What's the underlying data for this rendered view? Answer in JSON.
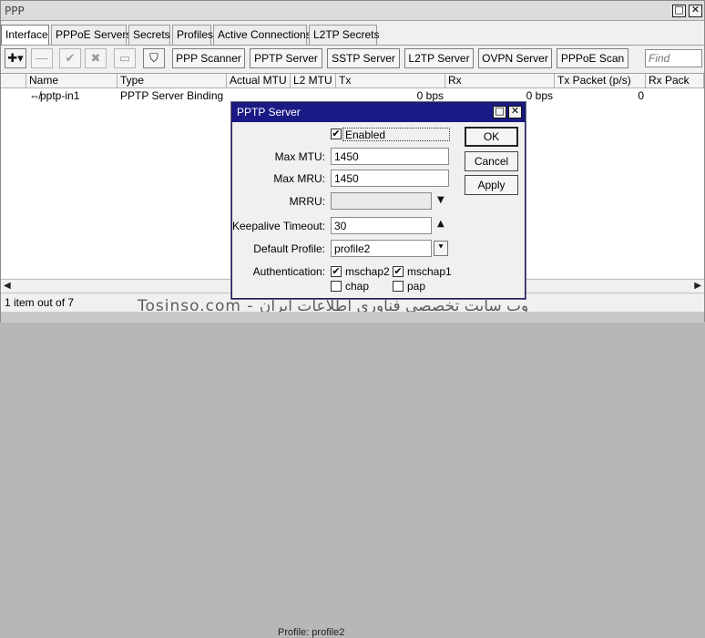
{
  "window": {
    "title": "PPP",
    "restore_glyph": "□",
    "close_glyph": "✕"
  },
  "tabs": [
    {
      "label": "Interface",
      "active": true
    },
    {
      "label": "PPPoE Servers"
    },
    {
      "label": "Secrets"
    },
    {
      "label": "Profiles"
    },
    {
      "label": "Active Connections"
    },
    {
      "label": "L2TP Secrets"
    }
  ],
  "toolbar": {
    "icons": [
      {
        "name": "add-icon",
        "glyph": "✚▾"
      },
      {
        "name": "remove-icon",
        "glyph": "—"
      },
      {
        "name": "enable-icon",
        "glyph": "✔"
      },
      {
        "name": "disable-icon",
        "glyph": "✖"
      },
      {
        "name": "comment-icon",
        "glyph": "▭"
      },
      {
        "name": "filter-icon",
        "glyph": "⛉"
      }
    ],
    "buttons": [
      "PPP Scanner",
      "PPTP Server",
      "SSTP Server",
      "L2TP Server",
      "OVPN Server",
      "PPPoE Scan"
    ],
    "find_placeholder": "Find"
  },
  "table": {
    "columns": [
      "Name",
      "Type",
      "Actual MTU",
      "L2 MTU",
      "Tx",
      "Rx",
      "Tx Packet (p/s)",
      "Rx Pack"
    ],
    "rows": [
      {
        "name": "⇎pptp-in1",
        "type": "PPTP Server Binding",
        "actual_mtu": "",
        "l2_mtu": "",
        "tx": "0 bps",
        "rx": "0 bps",
        "tx_packet": "0",
        "rx_packet": ""
      }
    ]
  },
  "status": {
    "items": "1 item out of 7"
  },
  "watermark": "Tosinso.com - وب سایت تخصصی فناوری اطلاعات ایران",
  "bottom_strip": {
    "profile": "Profile:  profile2"
  },
  "dialog": {
    "title": "PPTP Server",
    "enabled": {
      "label": "Enabled",
      "checked": true
    },
    "max_mtu": {
      "label": "Max MTU:",
      "value": "1450"
    },
    "max_mru": {
      "label": "Max MRU:",
      "value": "1450"
    },
    "mrru": {
      "label": "MRRU:",
      "value": ""
    },
    "keepalive": {
      "label": "Keepalive Timeout:",
      "value": "30"
    },
    "default_profile": {
      "label": "Default Profile:",
      "value": "profile2"
    },
    "authentication": {
      "label": "Authentication:",
      "options": [
        {
          "label": "mschap2",
          "checked": true
        },
        {
          "label": "mschap1",
          "checked": true
        },
        {
          "label": "chap",
          "checked": false
        },
        {
          "label": "pap",
          "checked": false
        }
      ]
    },
    "buttons": {
      "ok": "OK",
      "cancel": "Cancel",
      "apply": "Apply"
    },
    "check_glyph": "✔",
    "arrows": {
      "down": "▼",
      "up": "▲",
      "dropdown": "⯆"
    }
  }
}
